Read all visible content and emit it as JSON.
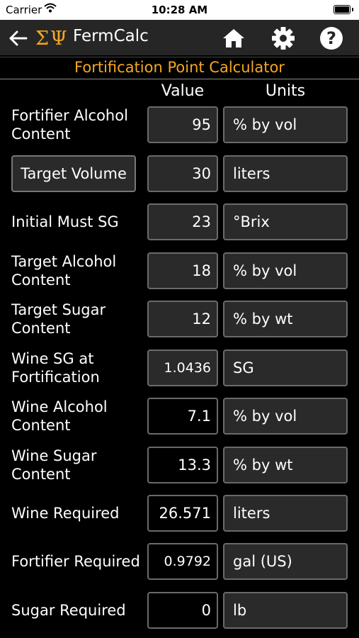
{
  "status_bar": {
    "carrier": "Carrier",
    "time": "10:28 AM"
  },
  "nav": {
    "app_name": "FermCalc"
  },
  "title": "Fortification Point Calculator",
  "columns": {
    "value": "Value",
    "units": "Units"
  },
  "rows": [
    {
      "label": "Fortifier Alcohol Content",
      "value": "95",
      "units": "% by vol"
    },
    {
      "label": "Target Volume",
      "value": "30",
      "units": "liters"
    },
    {
      "label": "Initial Must SG",
      "value": "23",
      "units": "°Brix"
    },
    {
      "label": "Target Alcohol Content",
      "value": "18",
      "units": "% by vol"
    },
    {
      "label": "Target Sugar Content",
      "value": "12",
      "units": "% by wt"
    },
    {
      "label": "Wine SG at Fortification",
      "value": "1.0436",
      "units": "SG"
    },
    {
      "label": "Wine Alcohol Content",
      "value": "7.1",
      "units": "% by vol"
    },
    {
      "label": "Wine Sugar Content",
      "value": "13.3",
      "units": "% by wt"
    },
    {
      "label": "Wine Required",
      "value": "26.571",
      "units": "liters"
    },
    {
      "label": "Fortifier Required",
      "value": "0.9792",
      "units": "gal (US)"
    },
    {
      "label": "Sugar Required",
      "value": "0",
      "units": "lb"
    }
  ],
  "colors": {
    "accent": "#f5a623",
    "background": "#000000",
    "navbar": "#262626"
  }
}
